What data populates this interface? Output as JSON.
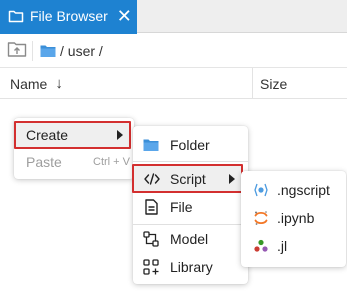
{
  "tab": {
    "title": "File Browser",
    "close_icon": "close-icon",
    "icon": "folder-icon"
  },
  "toolbar": {
    "up_icon": "folder-up-icon",
    "path": "/ user /"
  },
  "header": {
    "name_label": "Name",
    "sort_icon": "arrow-down-icon",
    "size_label": "Size"
  },
  "context_menu": {
    "items": [
      {
        "label": "Create",
        "highlighted": true,
        "submenu": true
      },
      {
        "label": "Paste",
        "shortcut": "Ctrl + V",
        "disabled": true
      }
    ]
  },
  "create_menu": {
    "items": [
      {
        "label": "Folder",
        "icon": "folder-icon"
      },
      {
        "label": "Script",
        "icon": "code-icon",
        "highlighted": true,
        "submenu": true
      },
      {
        "label": "File",
        "icon": "file-icon"
      },
      {
        "label": "Model",
        "icon": "model-icon"
      },
      {
        "label": "Library",
        "icon": "library-icon"
      }
    ]
  },
  "script_menu": {
    "items": [
      {
        "label": ".ngscript",
        "icon": "ngscript-icon"
      },
      {
        "label": ".ipynb",
        "icon": "jupyter-icon"
      },
      {
        "label": ".jl",
        "icon": "julia-icon"
      }
    ]
  },
  "colors": {
    "accent": "#1e82d1",
    "highlight_border": "#d32f2f",
    "folder": "#3b8fd8"
  }
}
